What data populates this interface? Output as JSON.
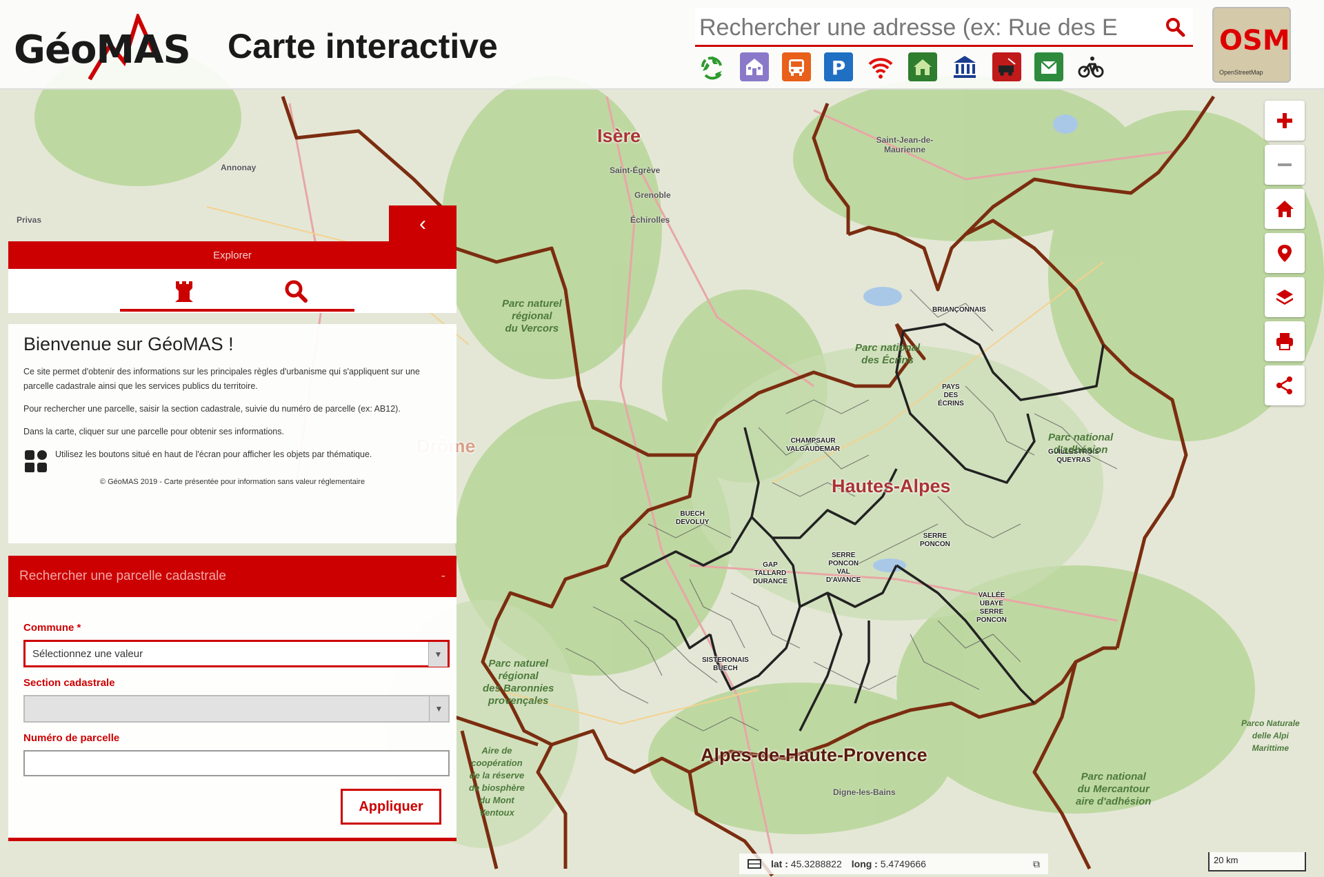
{
  "header": {
    "logo_text": "GéoMAS",
    "title": "Carte interactive",
    "search_placeholder": "Rechercher une adresse (ex: Rue des E",
    "osm_label": "OSM",
    "osm_sub": "OpenStreetMap"
  },
  "themes": [
    {
      "icon": "recycle-icon",
      "color": "#2e9a2e"
    },
    {
      "icon": "school-icon",
      "color": "#8a79c9"
    },
    {
      "icon": "bus-icon",
      "color": "#e8601a"
    },
    {
      "icon": "parking-icon",
      "color": "#1f6fc2"
    },
    {
      "icon": "wifi-icon",
      "color": "#e01010"
    },
    {
      "icon": "house-icon",
      "color": "#2f7d2f"
    },
    {
      "icon": "museum-icon",
      "color": "#1a3d8f"
    },
    {
      "icon": "fire-icon",
      "color": "#c01a1a"
    },
    {
      "icon": "mailbox-icon",
      "color": "#2e8b3e"
    },
    {
      "icon": "bicycle-icon",
      "color": "#222222"
    }
  ],
  "right_tools": [
    "zoom-in-icon",
    "zoom-out-icon",
    "home-icon",
    "locate-icon",
    "layers-icon",
    "print-icon",
    "share-icon"
  ],
  "explorer": {
    "header": "Explorer",
    "collapse_label": "‹"
  },
  "welcome": {
    "title": "Bienvenue sur GéoMAS !",
    "p1": "Ce site permet d'obtenir des informations sur les principales règles d'urbanisme qui s'appliquent sur une parcelle cadastrale ainsi que les services publics du territoire.",
    "p2": "Pour rechercher une parcelle, saisir la section cadastrale, suivie du numéro de parcelle (ex: AB12).",
    "p3": "Dans la carte, cliquer sur une parcelle pour obtenir ses informations.",
    "p4": "Utilisez les boutons situé en haut de l'écran pour afficher les objets par thématique.",
    "copyright": "© GéoMAS 2019 - Carte présentée pour information sans valeur réglementaire"
  },
  "parcel_form": {
    "header": "Rechercher une parcelle cadastrale",
    "collapse": "-",
    "commune_label": "Commune *",
    "commune_value": "Sélectionnez une valeur",
    "section_label": "Section cadastrale",
    "section_value": "",
    "numero_label": "Numéro de parcelle",
    "numero_value": "",
    "apply_label": "Appliquer"
  },
  "map": {
    "departments": [
      "Isère",
      "Drôme",
      "Hautes-Alpes",
      "Alpes-de-Haute-Provence"
    ],
    "sectors": [
      "BRIANÇONNAIS",
      "PAYS\nDES\nÉCRINS",
      "CHAMPSAUR\nVALGAUDEMAR",
      "GUILLESTROIS\nQUEYRAS",
      "BUECH\nDEVOLUY",
      "SERRE\nPONCON",
      "GAP\nTALLARD\nDURANCE",
      "SERRE\nPONCON\nVAL\nD'AVANCE",
      "VALLÉE\nUBAYE\nSERRE\nPONCON",
      "SISTERONAIS\nBUECH"
    ],
    "parks": [
      "Parc naturel\nrégional\ndu Vercors",
      "Parc national\ndes Écrins",
      "Parc national\nd'adhésion",
      "Parc naturel\nrégional\ndes Baronnies\nprovençales",
      "Parc national\ndu Mercantour\naire d'adhésion",
      "Aire de\ncoopération\nde la réserve\nde biosphère\ndu Mont\nVentoux",
      "Parco Naturale\ndelle Alpi\nMarittime"
    ],
    "towns": [
      "Annonay",
      "Saint-Égrève",
      "Grenoble",
      "Échirolles",
      "Saint-Jean-de-Maurienne",
      "Digne-les-Bains",
      "Privas"
    ]
  },
  "coords": {
    "lat_label": "lat :",
    "lat_value": "45.3288822",
    "lng_label": "long :",
    "lng_value": "5.4749666"
  },
  "scale": "20 km"
}
